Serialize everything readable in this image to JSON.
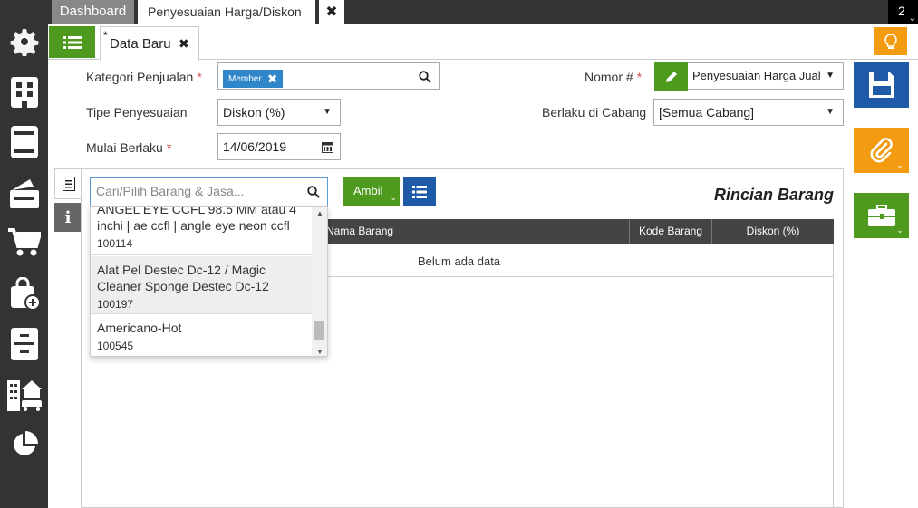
{
  "topbar": {
    "tabs": [
      "Dashboard",
      "Penyesuaian Harga/Diskon"
    ],
    "close_symbol": "✖",
    "counter": "2"
  },
  "subbar": {
    "doc_tab_star": "*",
    "doc_tab_title": "Data Baru",
    "doc_tab_close": "✖"
  },
  "form": {
    "kategori_label": "Kategori Penjualan",
    "kategori_chip": "Member",
    "chip_remove": "✖",
    "tipe_label": "Tipe Penyesuaian",
    "tipe_value": "Diskon (%)",
    "mulai_label": "Mulai Berlaku",
    "mulai_value": "14/06/2019",
    "nomor_label": "Nomor #",
    "nomor_value": "Penyesuaian Harga Jual",
    "cabang_label": "Berlaku di Cabang",
    "cabang_value": "[Semua Cabang]",
    "required_mark": "*"
  },
  "items": {
    "search_placeholder": "Cari/Pilih Barang & Jasa...",
    "ambil_label": "Ambil",
    "section_title": "Rincian Barang",
    "columns": [
      "Nama Barang",
      "Kode Barang",
      "Diskon (%)"
    ],
    "empty_text": "Belum ada data"
  },
  "dropdown": {
    "items": [
      {
        "name": "ANGEL EYE CCFL 98.5 MM atau 4 inchi | ae ccfl | angle eye neon ccfl",
        "code": "100114"
      },
      {
        "name": "Alat Pel Destec Dc-12 / Magic Cleaner Sponge Destec Dc-12",
        "code": "100197"
      },
      {
        "name": "Americano-Hot",
        "code": "100545"
      }
    ]
  },
  "icons": {
    "sidebar": [
      "gear-icon",
      "building-icon",
      "ledger-icon",
      "wallet-icon",
      "cart-icon",
      "bag-add-icon",
      "archive-icon",
      "city-icon",
      "pie-chart-icon"
    ],
    "accent_colors": {
      "green": "#4e9a1e",
      "blue": "#1e5aa8",
      "orange": "#f39c12",
      "dark": "#333333"
    }
  }
}
